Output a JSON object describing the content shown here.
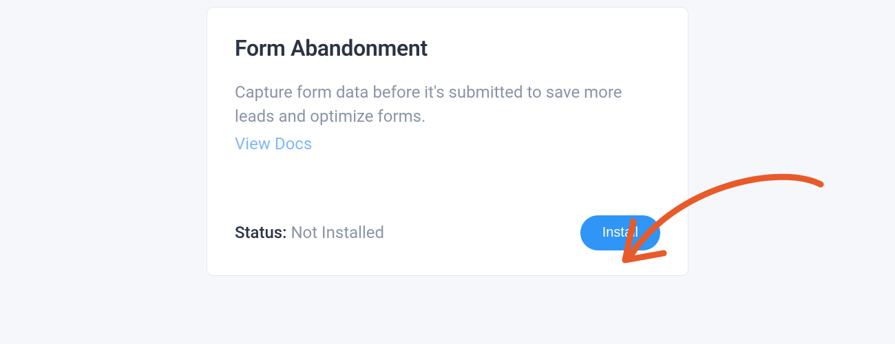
{
  "card": {
    "title": "Form Abandonment",
    "description": "Capture form data before it's submitted to save more leads and optimize forms.",
    "view_docs_label": "View Docs",
    "status_label": "Status:",
    "status_value": "Not Installed",
    "install_label": "Install"
  },
  "colors": {
    "accent": "#2f95f7",
    "arrow": "#e85a2a"
  }
}
